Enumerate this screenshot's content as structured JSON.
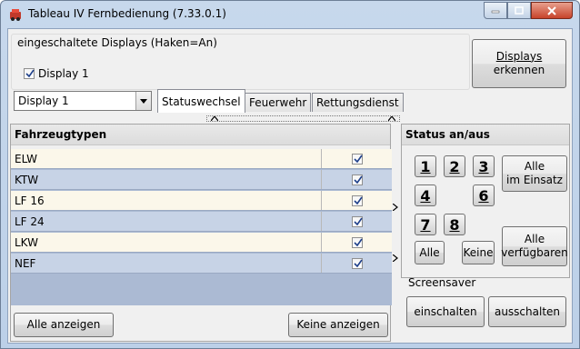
{
  "window": {
    "title": "Tableau IV Fernbedienung (7.33.0.1)"
  },
  "displays": {
    "group_title": "eingeschaltete Displays (Haken=An)",
    "items": [
      {
        "label": "Display 1",
        "checked": true
      }
    ],
    "detect_button_line1": "Displays",
    "detect_button_line2": "erkennen"
  },
  "combo": {
    "selected": "Display 1"
  },
  "tabs": [
    {
      "label": "Statuswechsel",
      "active": true
    },
    {
      "label": "Feuerwehr",
      "active": false
    },
    {
      "label": "Rettungsdienst",
      "active": false
    }
  ],
  "vehicles": {
    "header": "Fahrzeugtypen",
    "rows": [
      {
        "name": "ELW",
        "checked": true
      },
      {
        "name": "KTW",
        "checked": true
      },
      {
        "name": "LF 16",
        "checked": true
      },
      {
        "name": "LF 24",
        "checked": true
      },
      {
        "name": "LKW",
        "checked": true
      },
      {
        "name": "NEF",
        "checked": true
      }
    ],
    "show_all_label": "Alle anzeigen",
    "show_none_label": "Keine anzeigen"
  },
  "status": {
    "header": "Status an/aus",
    "numbers": [
      "1",
      "2",
      "3",
      "4",
      "6",
      "7",
      "8"
    ],
    "all_label": "Alle",
    "none_label": "Keine",
    "all_in_use_line1": "Alle",
    "all_in_use_line2": "im Einsatz",
    "all_available_line1": "Alle",
    "all_available_line2": "verfügbaren"
  },
  "screensaver": {
    "label": "Screensaver",
    "on_label": "einschalten",
    "off_label": "ausschalten"
  },
  "colors": {
    "grid_row_odd": "#fbf7ea",
    "grid_row_even": "#c7d3e6",
    "grid_background": "#abbad3"
  }
}
